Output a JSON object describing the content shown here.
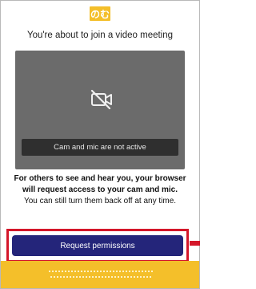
{
  "brand": {
    "logo_text": "のむ",
    "accent": "#f4bf2a"
  },
  "header": {
    "title": "You're about to join a video meeting"
  },
  "preview": {
    "icon": "camera-off-icon",
    "status_text": "Cam and mic are not active"
  },
  "info": {
    "strong_text": "For others to see and hear you, your browser will request access to your cam and mic.",
    "normal_text": "You can still turn them back off at any time."
  },
  "cta": {
    "label": "Request permissions",
    "color": "#24257a",
    "highlight_color": "#d4172a"
  }
}
